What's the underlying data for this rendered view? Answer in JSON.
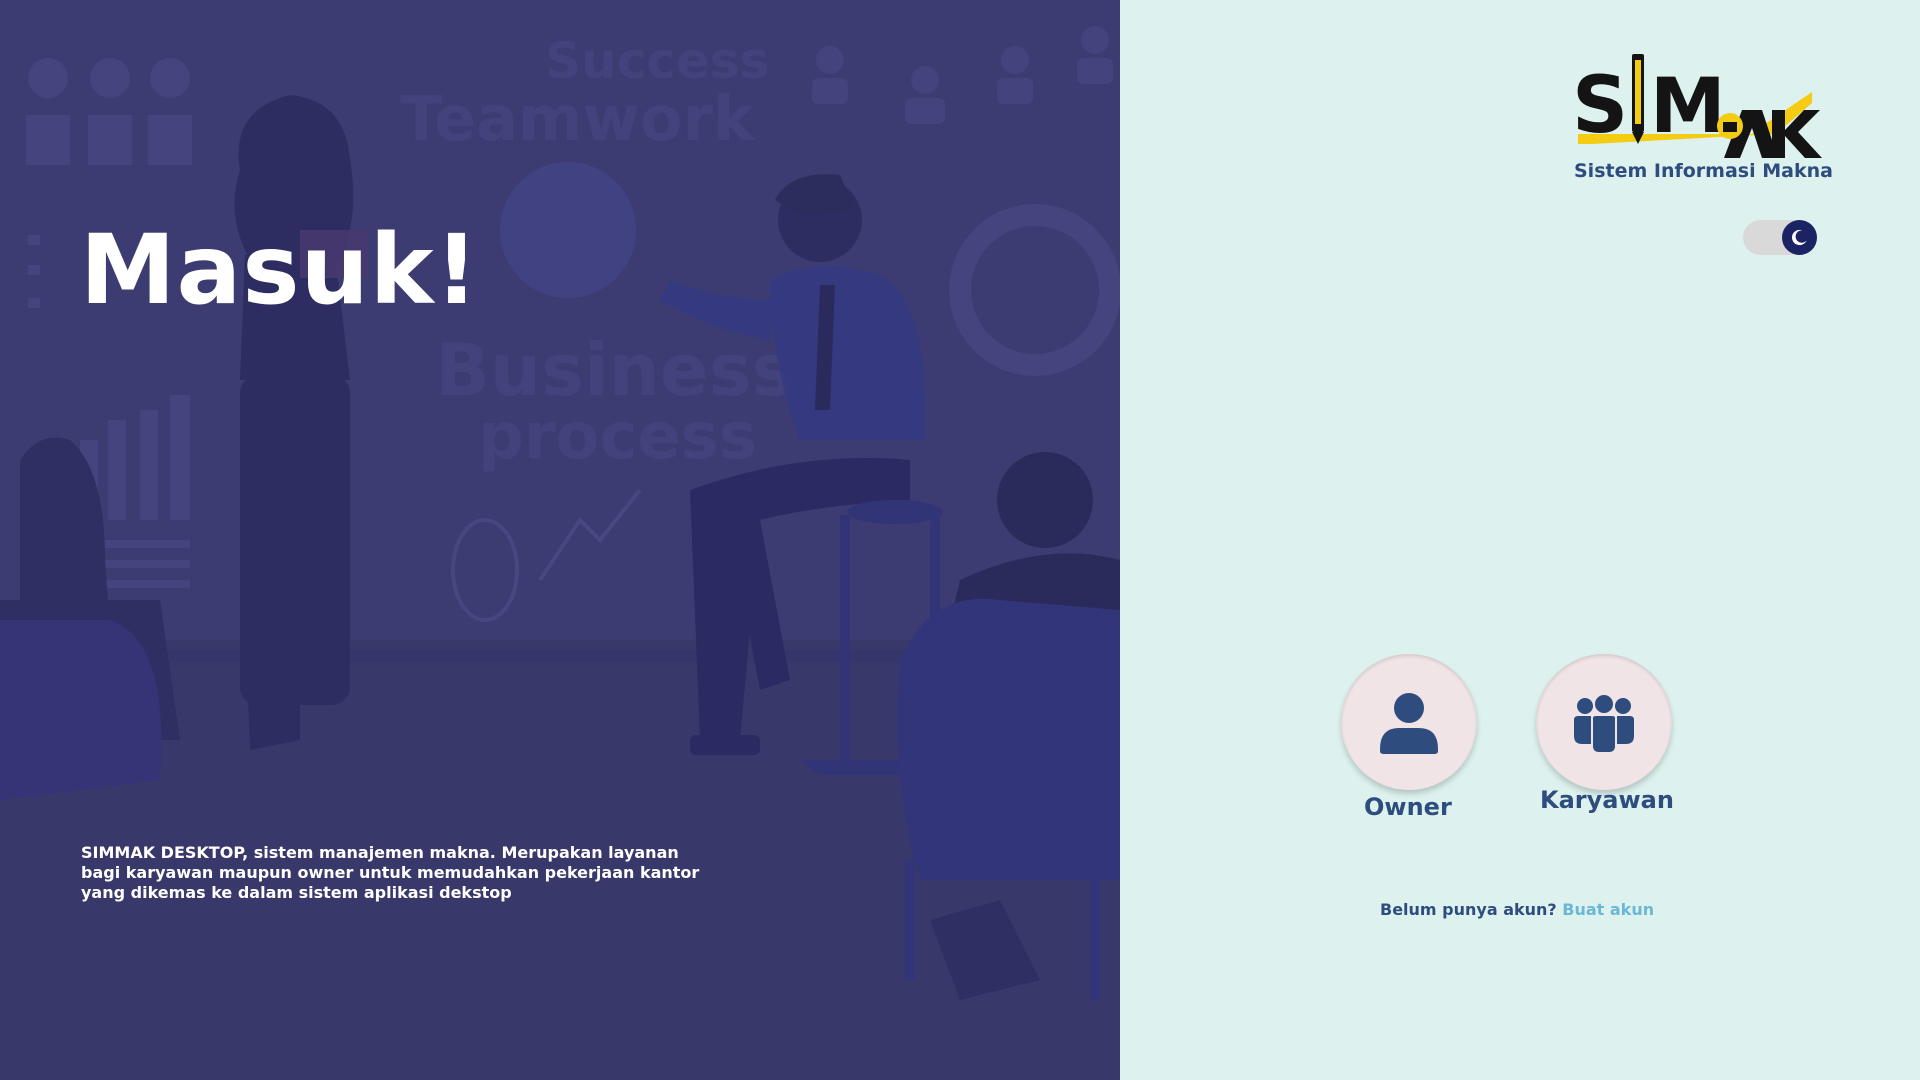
{
  "hero": {
    "title": "Masuk!",
    "description_lines": [
      "SIMMAK DESKTOP, sistem manajemen makna.  Merupakan layanan",
      "bagi karyawan maupun owner untuk memudahkan pekerjaan kantor",
      "yang dikemas ke dalam sistem aplikasi dekstop"
    ],
    "background_color": "#3c3c72",
    "illustration": "office-team-presentation-illustration",
    "poster_words": [
      "Success",
      "Teamwork",
      "Business",
      "process"
    ]
  },
  "logo": {
    "text": "SIMMAK",
    "subtitle": "Sistem Informasi Makna",
    "accent_color": "#f5cc14"
  },
  "theme_toggle": {
    "icon": "moon-icon",
    "mode": "light"
  },
  "roles": [
    {
      "label": "Owner",
      "icon": "user-icon"
    },
    {
      "label": "Karyawan",
      "icon": "users-group-icon"
    }
  ],
  "signup": {
    "prompt": "Belum punya akun?",
    "link": "Buat akun"
  },
  "colors": {
    "right_panel_bg": "#ddf2ef",
    "primary_text": "#2e4d7e",
    "link": "#6ab8d6",
    "role_button_bg": "#f0e4e6",
    "toggle_knob": "#1b2364"
  }
}
